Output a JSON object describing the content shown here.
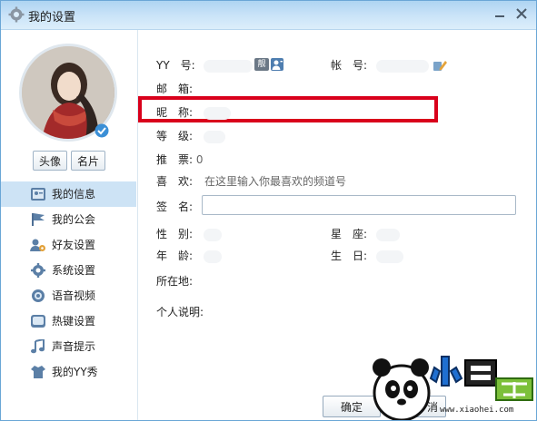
{
  "window": {
    "title": "我的设置"
  },
  "left": {
    "buttons": {
      "avatar": "头像",
      "card": "名片"
    },
    "nav": [
      {
        "label": "我的信息",
        "icon": "profile-card-icon",
        "active": true
      },
      {
        "label": "我的公会",
        "icon": "flag-icon",
        "active": false
      },
      {
        "label": "好友设置",
        "icon": "friend-settings-icon",
        "active": false
      },
      {
        "label": "系统设置",
        "icon": "gear-icon",
        "active": false
      },
      {
        "label": "语音视频",
        "icon": "voice-video-icon",
        "active": false
      },
      {
        "label": "热键设置",
        "icon": "hotkey-icon",
        "active": false
      },
      {
        "label": "声音提示",
        "icon": "music-note-icon",
        "active": false
      },
      {
        "label": "我的YY秀",
        "icon": "shirt-icon",
        "active": false
      }
    ]
  },
  "profile": {
    "yy_label": "YY　号:",
    "nice_badge": "靓",
    "account_label": "帐　号:",
    "email_label": "邮　箱:",
    "nickname_label": "昵　称:",
    "level_label": "等　级:",
    "recommend_label": "推　票:",
    "recommend_value": "0",
    "likes_label": "喜　欢:",
    "likes_placeholder": "在这里输入你最喜欢的频道号",
    "signature_label": "签　名:",
    "gender_label": "性　别:",
    "zodiac_label": "星　座:",
    "age_label": "年　龄:",
    "birthday_label": "生　日:",
    "location_label": "所在地:",
    "bio_label": "个人说明:"
  },
  "footer": {
    "ok": "确定",
    "cancel": "消"
  },
  "watermark": {
    "url": "www.xiaohei.com"
  },
  "colors": {
    "highlight": "#d9001b",
    "nav_active": "#cde3f5",
    "titlebar": "#c9e3f8"
  }
}
